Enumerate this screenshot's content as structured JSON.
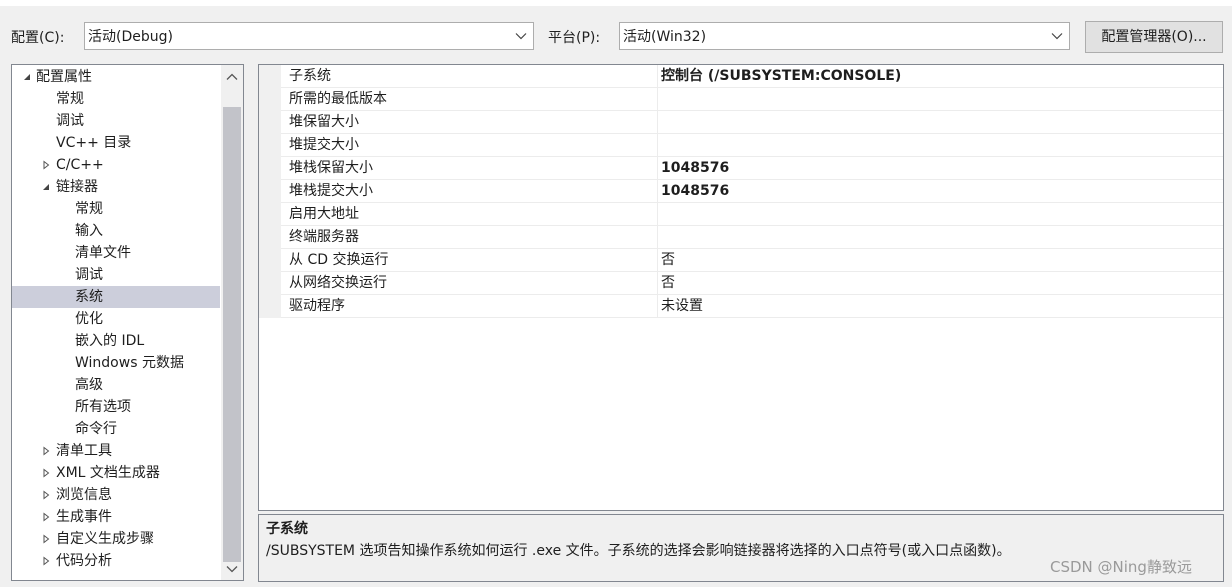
{
  "toolbar": {
    "config_label": "配置(C):",
    "config_value": "活动(Debug)",
    "platform_label": "平台(P):",
    "platform_value": "活动(Win32)",
    "config_manager_button": "配置管理器(O)..."
  },
  "tree": {
    "items": [
      {
        "label": "配置属性",
        "level": 0,
        "toggle": "expanded",
        "selected": false
      },
      {
        "label": "常规",
        "level": 1,
        "toggle": "none",
        "selected": false
      },
      {
        "label": "调试",
        "level": 1,
        "toggle": "none",
        "selected": false
      },
      {
        "label": "VC++ 目录",
        "level": 1,
        "toggle": "none",
        "selected": false
      },
      {
        "label": "C/C++",
        "level": 1,
        "toggle": "collapsed",
        "selected": false
      },
      {
        "label": "链接器",
        "level": 1,
        "toggle": "expanded",
        "selected": false
      },
      {
        "label": "常规",
        "level": 2,
        "toggle": "none",
        "selected": false
      },
      {
        "label": "输入",
        "level": 2,
        "toggle": "none",
        "selected": false
      },
      {
        "label": "清单文件",
        "level": 2,
        "toggle": "none",
        "selected": false
      },
      {
        "label": "调试",
        "level": 2,
        "toggle": "none",
        "selected": false
      },
      {
        "label": "系统",
        "level": 2,
        "toggle": "none",
        "selected": true
      },
      {
        "label": "优化",
        "level": 2,
        "toggle": "none",
        "selected": false
      },
      {
        "label": "嵌入的 IDL",
        "level": 2,
        "toggle": "none",
        "selected": false
      },
      {
        "label": "Windows 元数据",
        "level": 2,
        "toggle": "none",
        "selected": false
      },
      {
        "label": "高级",
        "level": 2,
        "toggle": "none",
        "selected": false
      },
      {
        "label": "所有选项",
        "level": 2,
        "toggle": "none",
        "selected": false
      },
      {
        "label": "命令行",
        "level": 2,
        "toggle": "none",
        "selected": false
      },
      {
        "label": "清单工具",
        "level": 1,
        "toggle": "collapsed",
        "selected": false
      },
      {
        "label": "XML 文档生成器",
        "level": 1,
        "toggle": "collapsed",
        "selected": false
      },
      {
        "label": "浏览信息",
        "level": 1,
        "toggle": "collapsed",
        "selected": false
      },
      {
        "label": "生成事件",
        "level": 1,
        "toggle": "collapsed",
        "selected": false
      },
      {
        "label": "自定义生成步骤",
        "level": 1,
        "toggle": "collapsed",
        "selected": false
      },
      {
        "label": "代码分析",
        "level": 1,
        "toggle": "collapsed",
        "selected": false
      }
    ]
  },
  "properties": {
    "rows": [
      {
        "name": "子系统",
        "value": "控制台 (/SUBSYSTEM:CONSOLE)",
        "bold": true
      },
      {
        "name": "所需的最低版本",
        "value": "",
        "bold": false
      },
      {
        "name": "堆保留大小",
        "value": "",
        "bold": false
      },
      {
        "name": "堆提交大小",
        "value": "",
        "bold": false
      },
      {
        "name": "堆栈保留大小",
        "value": "1048576",
        "bold": true
      },
      {
        "name": "堆栈提交大小",
        "value": "1048576",
        "bold": true
      },
      {
        "name": "启用大地址",
        "value": "",
        "bold": false
      },
      {
        "name": "终端服务器",
        "value": "",
        "bold": false
      },
      {
        "name": "从 CD 交换运行",
        "value": "否",
        "bold": false
      },
      {
        "name": "从网络交换运行",
        "value": "否",
        "bold": false
      },
      {
        "name": "驱动程序",
        "value": "未设置",
        "bold": false
      }
    ]
  },
  "description": {
    "title": "子系统",
    "text": "/SUBSYSTEM 选项告知操作系统如何运行 .exe 文件。子系统的选择会影响链接器将选择的入口点符号(或入口点函数)。"
  },
  "watermark": "CSDN @Ning静致远",
  "icons": {
    "dropdown": "chevron-down-icon",
    "expanded": "expanded-triangle-icon",
    "collapsed": "collapsed-triangle-icon",
    "scroll_up": "chevron-up-icon",
    "scroll_down": "chevron-down-icon"
  },
  "colors": {
    "selection": "#cccedb",
    "window_bg": "#f0f0f0",
    "border": "#828790"
  }
}
